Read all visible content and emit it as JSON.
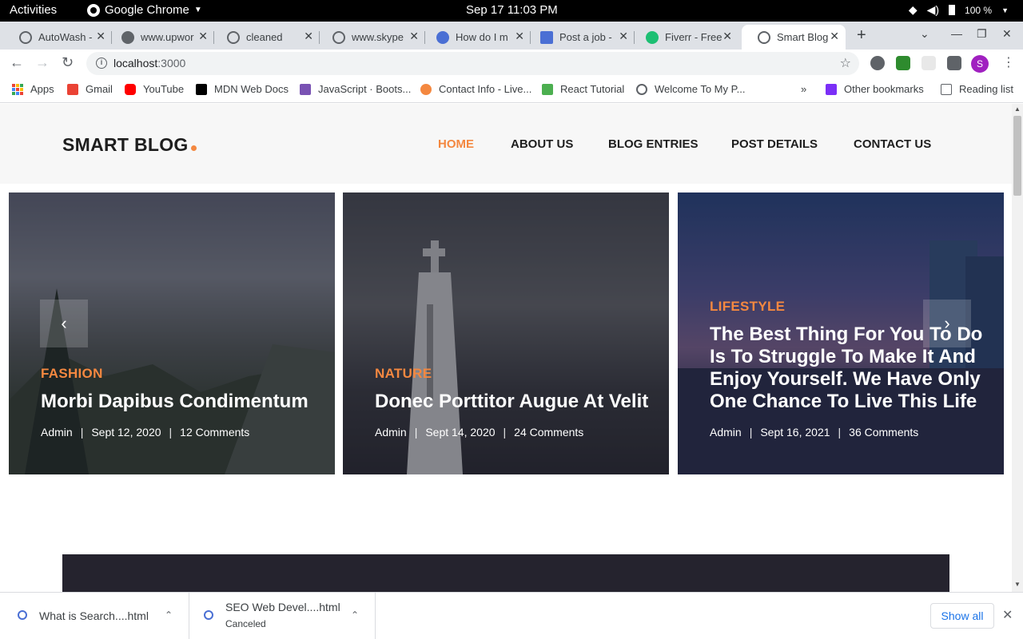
{
  "system": {
    "activities": "Activities",
    "app_name": "Google Chrome",
    "clock": "Sep 17  11:03 PM",
    "battery": "100 %"
  },
  "tabs": [
    {
      "label": "AutoWash -",
      "color": "#5f6368"
    },
    {
      "label": "www.upwor",
      "color": "#5f6368"
    },
    {
      "label": "cleaned",
      "color": "#5f6368"
    },
    {
      "label": "www.skype",
      "color": "#5f6368"
    },
    {
      "label": "How do I m",
      "color": "#4a6fd4"
    },
    {
      "label": "Post a job -",
      "color": "#4a6fd4"
    },
    {
      "label": "Fiverr - Free",
      "color": "#1dbf73"
    },
    {
      "label": "Smart Blog",
      "color": "#5f6368"
    }
  ],
  "toolbar": {
    "url_host": "localhost",
    "url_port": ":3000",
    "profile_initial": "S"
  },
  "bookmarks": [
    {
      "label": "Apps"
    },
    {
      "label": "Gmail",
      "color": "#ea4335"
    },
    {
      "label": "YouTube",
      "color": "#ff0000"
    },
    {
      "label": "MDN Web Docs",
      "color": "#000000"
    },
    {
      "label": "JavaScript · Boots...",
      "color": "#7952b3"
    },
    {
      "label": "Contact Info - Live...",
      "color": "#f48840"
    },
    {
      "label": "React Tutorial",
      "color": "#4caf50"
    },
    {
      "label": "Welcome To My P...",
      "color": "#5f6368"
    },
    {
      "label": "Other bookmarks",
      "color": "#7b2ff7"
    },
    {
      "label": "Reading list",
      "color": "#5f6368"
    }
  ],
  "site": {
    "logo": "SMART BLOG",
    "nav": [
      "HOME",
      "ABOUT US",
      "BLOG ENTRIES",
      "POST DETAILS",
      "CONTACT US"
    ],
    "accent": "#f48840",
    "cards": [
      {
        "category": "FASHION",
        "title": "Morbi Dapibus Condimentum",
        "author": "Admin",
        "date": "Sept 12, 2020",
        "comments": "12 Comments"
      },
      {
        "category": "NATURE",
        "title": "Donec Porttitor Augue At Velit",
        "author": "Admin",
        "date": "Sept 14, 2020",
        "comments": "24 Comments"
      },
      {
        "category": "LIFESTYLE",
        "title": "The Best Thing For You To Do Is To Struggle To Make It And Enjoy Yourself. We Have Only One Chance To Live This Life",
        "author": "Admin",
        "date": "Sept 16, 2021",
        "comments": "36 Comments"
      }
    ],
    "prev_arrow": "‹",
    "next_arrow": "›"
  },
  "downloads": {
    "items": [
      {
        "name": "What is Search....html",
        "status": ""
      },
      {
        "name": "SEO Web Devel....html",
        "status": "Canceled"
      }
    ],
    "show_all": "Show all"
  }
}
